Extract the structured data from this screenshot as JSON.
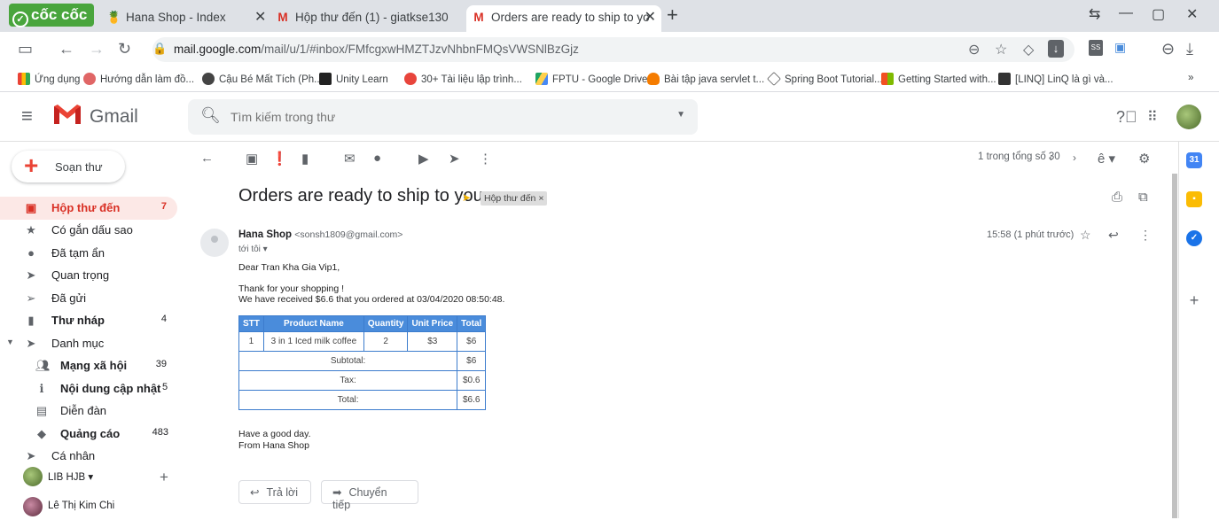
{
  "browser": {
    "brand": "cốc cốc",
    "tabs": [
      {
        "title": "Hana Shop - Index",
        "icon": "🍍"
      },
      {
        "title": "Hộp thư đến (1) - giatkse130",
        "icon": "M"
      },
      {
        "title": "Orders are ready to ship to yo",
        "icon": "M"
      }
    ],
    "url_host": "mail.google.com",
    "url_path": "/mail/u/1/#inbox/FMfcgxwHMZTJzvNhbnFMQsVWSNlBzGjz",
    "bookmarks": [
      "Ứng dụng",
      "Hướng dẫn làm đồ...",
      "Cậu Bé Mất Tích (Ph...",
      "Unity Learn",
      "30+ Tài liệu lập trình...",
      "FPTU - Google Drive",
      "Bài tập java servlet t...",
      "Spring Boot Tutorial...",
      "Getting Started with...",
      "[LINQ] LinQ là gì và..."
    ]
  },
  "gmail": {
    "app_name": "Gmail",
    "search_placeholder": "Tìm kiếm trong thư",
    "compose_label": "Soạn thư",
    "nav": [
      {
        "label": "Hộp thư đến",
        "count": "7"
      },
      {
        "label": "Có gắn dấu sao",
        "count": ""
      },
      {
        "label": "Đã tạm ẩn",
        "count": ""
      },
      {
        "label": "Quan trọng",
        "count": ""
      },
      {
        "label": "Đã gửi",
        "count": ""
      },
      {
        "label": "Thư nháp",
        "count": "4"
      },
      {
        "label": "Danh mục",
        "count": ""
      },
      {
        "label": "Mạng xã hội",
        "count": "39"
      },
      {
        "label": "Nội dung cập nhật",
        "count": "5"
      },
      {
        "label": "Diễn đàn",
        "count": ""
      },
      {
        "label": "Quảng cáo",
        "count": "483"
      },
      {
        "label": "Cá nhân",
        "count": ""
      }
    ],
    "hangouts_user": "LIB HJB",
    "hangouts_contact": "Lê Thị Kim Chi",
    "pager_text": "1 trong tổng số 30"
  },
  "message": {
    "subject": "Orders are ready to ship to you",
    "label_chip": "Hộp thư đến ×",
    "sender_name": "Hana Shop",
    "sender_email": "<sonsh1809@gmail.com>",
    "to_line": "tới tôi ▾",
    "time": "15:58 (1 phút trước)",
    "greeting": "Dear Tran Kha Gia Vip1,",
    "line1": "Thank for your shopping !",
    "line2": "We have received $6.6 that you ordered at 03/04/2020 08:50:48.",
    "table": {
      "headers": [
        "STT",
        "Product Name",
        "Quantity",
        "Unit Price",
        "Total"
      ],
      "row": [
        "1",
        "3 in 1 Iced milk coffee",
        "2",
        "$3",
        "$6"
      ],
      "subtotal_label": "Subtotal:",
      "subtotal": "$6",
      "tax_label": "Tax:",
      "tax": "$0.6",
      "total_label": "Total:",
      "total": "$6.6"
    },
    "closing1": "Have a good day.",
    "closing2": "From Hana Shop",
    "reply_label": "Trả lời",
    "forward_label": "Chuyển tiếp"
  },
  "colors": {
    "accent_red": "#d93025",
    "table_header": "#4a8cdb",
    "coccoc_green": "#49a53d"
  }
}
